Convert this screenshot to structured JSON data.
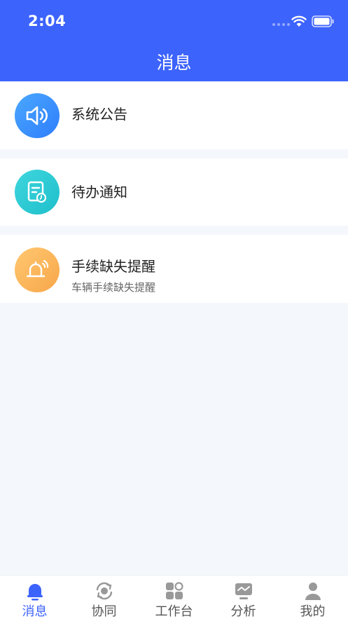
{
  "status": {
    "time": "2:04"
  },
  "header": {
    "title": "消息"
  },
  "messages": [
    {
      "title": "系统公告",
      "icon": "speaker-icon"
    },
    {
      "title": "待办通知",
      "icon": "todo-document-icon"
    },
    {
      "title": "手续缺失提醒",
      "subtitle": "车辆手续缺失提醒",
      "icon": "bell-ringing-icon"
    }
  ],
  "tabs": [
    {
      "label": "消息",
      "icon": "bell-icon",
      "active": true
    },
    {
      "label": "协同",
      "icon": "sync-circle-icon"
    },
    {
      "label": "工作台",
      "icon": "grid-apps-icon"
    },
    {
      "label": "分析",
      "icon": "monitor-chart-icon"
    },
    {
      "label": "我的",
      "icon": "user-icon"
    }
  ],
  "colors": {
    "primary": "#3d63fd",
    "background": "#f4f7fb",
    "announcement_gradient": [
      "#4aa8ff",
      "#2f7dfb"
    ],
    "todo_gradient": [
      "#3fd6de",
      "#1ebfcb"
    ],
    "reminder_gradient": [
      "#ffc870",
      "#f8a64a"
    ],
    "tab_inactive": "#999999"
  }
}
